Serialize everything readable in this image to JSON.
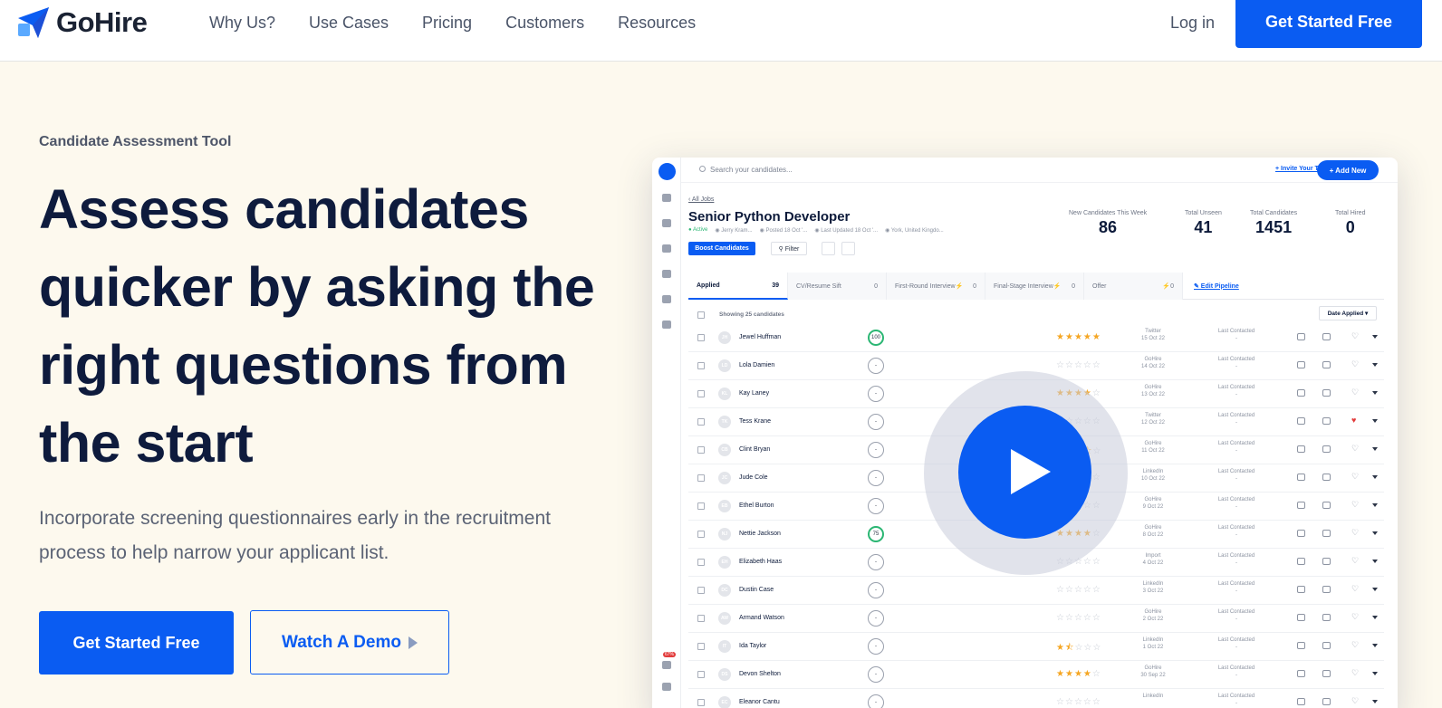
{
  "brand": {
    "name": "GoHire"
  },
  "nav": {
    "links": [
      "Why Us?",
      "Use Cases",
      "Pricing",
      "Customers",
      "Resources"
    ],
    "login": "Log in",
    "cta": "Get Started Free"
  },
  "hero": {
    "eyebrow": "Candidate Assessment Tool",
    "headline": "Assess candidates quicker by asking the right questions from the start",
    "subtext": "Incorporate screening questionnaires early in the recruitment process to help narrow your applicant list.",
    "primary_cta": "Get Started Free",
    "secondary_cta": "Watch A Demo"
  },
  "app": {
    "search_placeholder": "Search your candidates...",
    "invite": "+ Invite Your Team",
    "add_new": "+ Add New",
    "all_jobs": "‹ All Jobs",
    "job_title": "Senior Python Developer",
    "job_meta": [
      "● Active",
      "◉ Jerry Kram...",
      "◉ Posted 18 Oct '...",
      "◉ Last Updated 18 Oct '...",
      "◉ York, United Kingdo..."
    ],
    "boost": "Boost Candidates",
    "filter": "⚲ Filter",
    "stats": [
      {
        "label": "New Candidates This Week",
        "value": "86"
      },
      {
        "label": "Total Unseen",
        "value": "41"
      },
      {
        "label": "Total Candidates",
        "value": "1451"
      },
      {
        "label": "Total Hired",
        "value": "0"
      }
    ],
    "tabs": [
      {
        "label": "Applied",
        "count": "39"
      },
      {
        "label": "CV/Resume Sift",
        "count": "0"
      },
      {
        "label": "First-Round Interview⚡",
        "count": "0"
      },
      {
        "label": "Final-Stage Interview⚡",
        "count": "0"
      },
      {
        "label": "Offer",
        "count": "⚡0"
      }
    ],
    "edit_pipeline": "✎ Edit Pipeline",
    "showing": "Showing 25 candidates",
    "sort": "Date Applied ▾",
    "badge": "67%",
    "candidates": [
      {
        "initials": "JH",
        "name": "Jewel Huffman",
        "score": "100",
        "rating": 5,
        "source": "Twitter",
        "date": "15 Oct 22",
        "contacted": "Last Contacted",
        "liked": false
      },
      {
        "initials": "LD",
        "name": "Lola Damien",
        "score": "-",
        "rating": 0,
        "source": "GoHire",
        "date": "14 Oct 22",
        "contacted": "Last Contacted",
        "liked": false
      },
      {
        "initials": "KL",
        "name": "Kay Laney",
        "score": "-",
        "rating": 4,
        "source": "GoHire",
        "date": "13 Oct 22",
        "contacted": "Last Contacted",
        "liked": false
      },
      {
        "initials": "TK",
        "name": "Tess Krane",
        "score": "-",
        "rating": 0,
        "source": "Twitter",
        "date": "12 Oct 22",
        "contacted": "Last Contacted",
        "liked": true
      },
      {
        "initials": "CB",
        "name": "Clint Bryan",
        "score": "-",
        "rating": 3.5,
        "source": "GoHire",
        "date": "11 Oct 22",
        "contacted": "Last Contacted",
        "liked": false
      },
      {
        "initials": "JC",
        "name": "Jude Cole",
        "score": "-",
        "rating": 0,
        "source": "LinkedIn",
        "date": "10 Oct 22",
        "contacted": "Last Contacted",
        "liked": false
      },
      {
        "initials": "EB",
        "name": "Ethel Burton",
        "score": "-",
        "rating": 0,
        "source": "GoHire",
        "date": "9 Oct 22",
        "contacted": "Last Contacted",
        "liked": false
      },
      {
        "initials": "NJ",
        "name": "Nettie Jackson",
        "score": "75",
        "rating": 4,
        "source": "GoHire",
        "date": "8 Oct 22",
        "contacted": "Last Contacted",
        "liked": false
      },
      {
        "initials": "EH",
        "name": "Elizabeth Haas",
        "score": "-",
        "rating": 0,
        "source": "Import",
        "date": "4 Oct 22",
        "contacted": "Last Contacted",
        "liked": false
      },
      {
        "initials": "DC",
        "name": "Dustin Case",
        "score": "-",
        "rating": 0,
        "source": "LinkedIn",
        "date": "3 Oct 22",
        "contacted": "Last Contacted",
        "liked": false
      },
      {
        "initials": "AW",
        "name": "Armand Watson",
        "score": "-",
        "rating": 0,
        "source": "GoHire",
        "date": "2 Oct 22",
        "contacted": "Last Contacted",
        "liked": false
      },
      {
        "initials": "IT",
        "name": "Ida Taylor",
        "score": "-",
        "rating": 1.5,
        "source": "LinkedIn",
        "date": "1 Oct 22",
        "contacted": "Last Contacted",
        "liked": false
      },
      {
        "initials": "DS",
        "name": "Devon Shelton",
        "score": "-",
        "rating": 4,
        "source": "GoHire",
        "date": "30 Sep 22",
        "contacted": "Last Contacted",
        "liked": false
      },
      {
        "initials": "EC",
        "name": "Eleanor Cantu",
        "score": "-",
        "rating": 0,
        "source": "LinkedIn",
        "date": "",
        "contacted": "Last Contacted",
        "liked": false
      }
    ]
  },
  "colors": {
    "brand_blue": "#0a5cf2",
    "hero_bg": "#fdf9ee",
    "star": "#f5a623",
    "heart": "#e23b3b"
  }
}
